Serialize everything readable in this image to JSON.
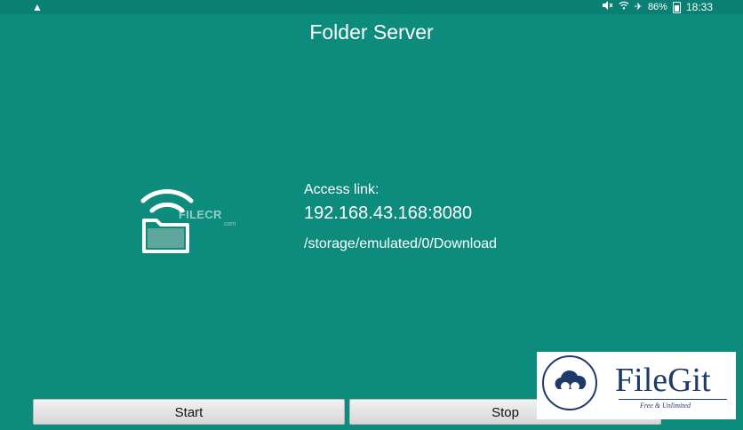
{
  "statusbar": {
    "warning_icon": "warning-triangle-icon",
    "battery": "86%",
    "time": "18:33"
  },
  "app": {
    "title": "Folder Server"
  },
  "server": {
    "access_label": "Access link:",
    "access_url": "192.168.43.168:8080",
    "folder_path": "/storage/emulated/0/Download"
  },
  "buttons": {
    "start": "Start",
    "stop": "Stop"
  },
  "watermarks": {
    "filecr": "FILECR",
    "filecr_sub": ".com",
    "filegit_name": "FileGit",
    "filegit_tag": "Free & Unlimited"
  },
  "colors": {
    "background": "#0d8c7e",
    "button": "#e4e4e4",
    "filegit_brand": "#1d3a6b"
  }
}
